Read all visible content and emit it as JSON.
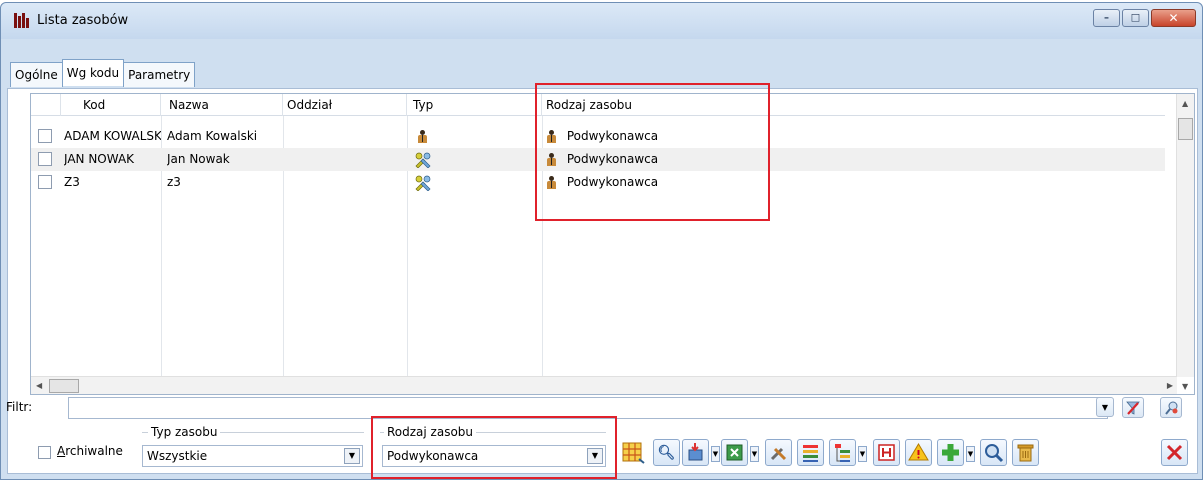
{
  "window": {
    "title": "Lista zasobów",
    "minimize_glyph": "–",
    "maximize_glyph": "□",
    "close_glyph": "✕"
  },
  "tabs": [
    {
      "label": "Ogólne"
    },
    {
      "label": "Wg kodu"
    },
    {
      "label": "Parametry"
    }
  ],
  "grid": {
    "columns": [
      "Kod",
      "Nazwa",
      "Oddział",
      "Typ",
      "Rodzaj zasobu"
    ],
    "rows": [
      {
        "kod": "ADAM KOWALSKI",
        "nazwa": "Adam Kowalski",
        "oddzial": "",
        "typ_icon": "person-icon",
        "rodzaj": "Podwykonawca"
      },
      {
        "kod": "JAN NOWAK",
        "nazwa": "Jan Nowak",
        "oddzial": "",
        "typ_icon": "tools-icon",
        "rodzaj": "Podwykonawca"
      },
      {
        "kod": "Z3",
        "nazwa": "z3",
        "oddzial": "",
        "typ_icon": "tools-icon",
        "rodzaj": "Podwykonawca"
      }
    ]
  },
  "filter": {
    "label": "Filtr:",
    "value": ""
  },
  "archiwalne": {
    "label": "Archiwalne"
  },
  "typ_zasobu": {
    "legend": "Typ zasobu",
    "value": "Wszystkie"
  },
  "rodzaj_zasobu": {
    "legend": "Rodzaj zasobu",
    "value": "Podwykonawca"
  },
  "colors": {
    "highlight": "#e0212b",
    "window_frame": "#cfdff0"
  }
}
